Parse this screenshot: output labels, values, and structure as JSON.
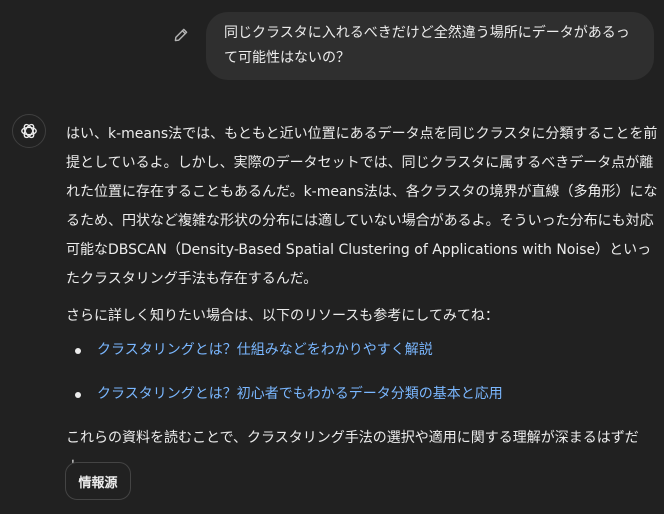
{
  "user_message": {
    "text": "同じクラスタに入れるべきだけど全然違う場所にデータがあるって可能性はないの？"
  },
  "assistant_message": {
    "paragraph_1": "はい、k-means法では、もともと近い位置にあるデータ点を同じクラスタに分類することを前提としているよ。しかし、実際のデータセットでは、同じクラスタに属するべきデータ点が離れた位置に存在することもあるんだ。k-means法は、各クラスタの境界が直線（多角形）になるため、円状など複雑な形状の分布には適していない場合があるよ。そういった分布にも対応可能なDBSCAN（Density-Based Spatial Clustering of Applications with Noise）といったクラスタリング手法も存在するんだ。",
    "paragraph_2": "さらに詳しく知りたい場合は、以下のリソースも参考にしてみてね：",
    "links": [
      {
        "label": "クラスタリングとは？仕組みなどをわかりやすく解説"
      },
      {
        "label": "クラスタリングとは？初心者でもわかるデータ分類の基本と応用"
      }
    ],
    "paragraph_3": "これらの資料を読むことで、クラスタリング手法の選択や適用に関する理解が深まるはずだよ。"
  },
  "sources_button": {
    "label": "情報源"
  },
  "icons": {
    "edit": "pencil-icon",
    "assistant_avatar": "openai-logo-icon"
  },
  "colors": {
    "background": "#212121",
    "user_bubble": "#2f2f2f",
    "text": "#ececec",
    "link": "#7ab7ff"
  }
}
